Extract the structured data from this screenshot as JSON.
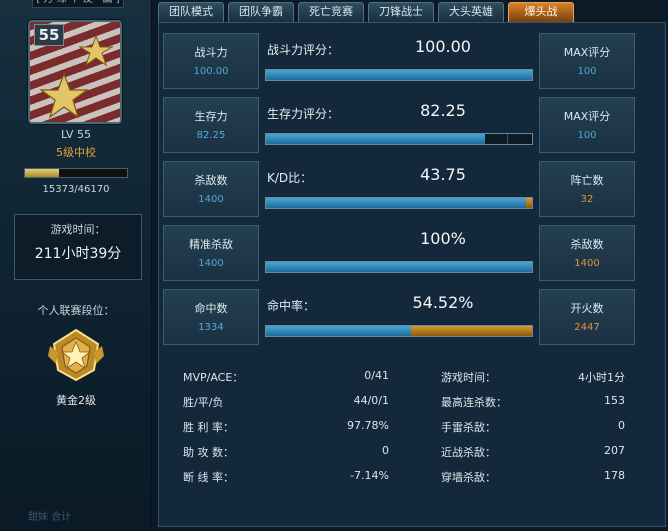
{
  "left": {
    "top_tag": "[ 万 缘 中 友 · 国 ]",
    "rank_number": "55",
    "level": "LV 55",
    "rank_name": "5级中校",
    "exp": {
      "current": 15373,
      "max": 46170,
      "text": "15373/46170",
      "fraction": 0.333
    },
    "playtime_label": "游戏时间：",
    "playtime_value": "211小时39分",
    "league_label": "个人联赛段位：",
    "league_name": "黄金2级",
    "footer": "甜妹   合计"
  },
  "tabs": [
    {
      "label": "团队模式",
      "active": false
    },
    {
      "label": "团队争霸",
      "active": false
    },
    {
      "label": "死亡竞赛",
      "active": false
    },
    {
      "label": "刀锋战士",
      "active": false
    },
    {
      "label": "大头英雄",
      "active": false
    },
    {
      "label": "爆头战",
      "active": true
    }
  ],
  "stats": [
    {
      "left_label": "战斗力",
      "left_value": "100.00",
      "mid_label": "战斗力评分：",
      "mid_value": "100.00",
      "right_label": "MAX评分",
      "right_value": "100",
      "right_orange": false,
      "fill": 1.0,
      "fill2": 0,
      "segments": []
    },
    {
      "left_label": "生存力",
      "left_value": "82.25",
      "mid_label": "生存力评分：",
      "mid_value": "82.25",
      "right_label": "MAX评分",
      "right_value": "100",
      "right_orange": false,
      "fill": 0.8225,
      "fill2": 0,
      "segments": [
        0.905
      ]
    },
    {
      "left_label": "杀敌数",
      "left_value": "1400",
      "mid_label": "K/D比：",
      "mid_value": "43.75",
      "right_label": "阵亡数",
      "right_value": "32",
      "right_orange": true,
      "fill": 0.977,
      "fill2": 0.023,
      "segments": []
    },
    {
      "left_label": "精准杀敌",
      "left_value": "1400",
      "mid_label": "",
      "mid_value": "100%",
      "right_label": "杀敌数",
      "right_value": "1400",
      "right_orange": true,
      "fill": 1.0,
      "fill2": 0,
      "segments": []
    },
    {
      "left_label": "命中数",
      "left_value": "1334",
      "mid_label": "命中率：",
      "mid_value": "54.52%",
      "right_label": "开火数",
      "right_value": "2447",
      "right_orange": true,
      "fill": 0.5452,
      "fill2": 0.4548,
      "segments": []
    }
  ],
  "details": [
    {
      "k1": "MVP/ACE：",
      "v1": "0/41",
      "k2": "游戏时间：",
      "v2": "4小时1分"
    },
    {
      "k1": "胜/平/负",
      "v1": "44/0/1",
      "k2": "最高连杀数：",
      "v2": "153"
    },
    {
      "k1": "胜 利 率：",
      "v1": "97.78%",
      "k2": "手雷杀敌：",
      "v2": "0"
    },
    {
      "k1": "助 攻 数：",
      "v1": "0",
      "k2": "近战杀敌：",
      "v2": "207"
    },
    {
      "k1": "断 线 率：",
      "v1": "-7.14%",
      "k2": "穿墙杀敌：",
      "v2": "178"
    }
  ],
  "colors": {
    "accent_blue": "#4aa7d6",
    "accent_orange": "#d69a2c",
    "rank_text": "#e8a33a"
  },
  "icons": {
    "rank": "major-rank-stars-icon",
    "league": "gold-league-badge-icon"
  }
}
